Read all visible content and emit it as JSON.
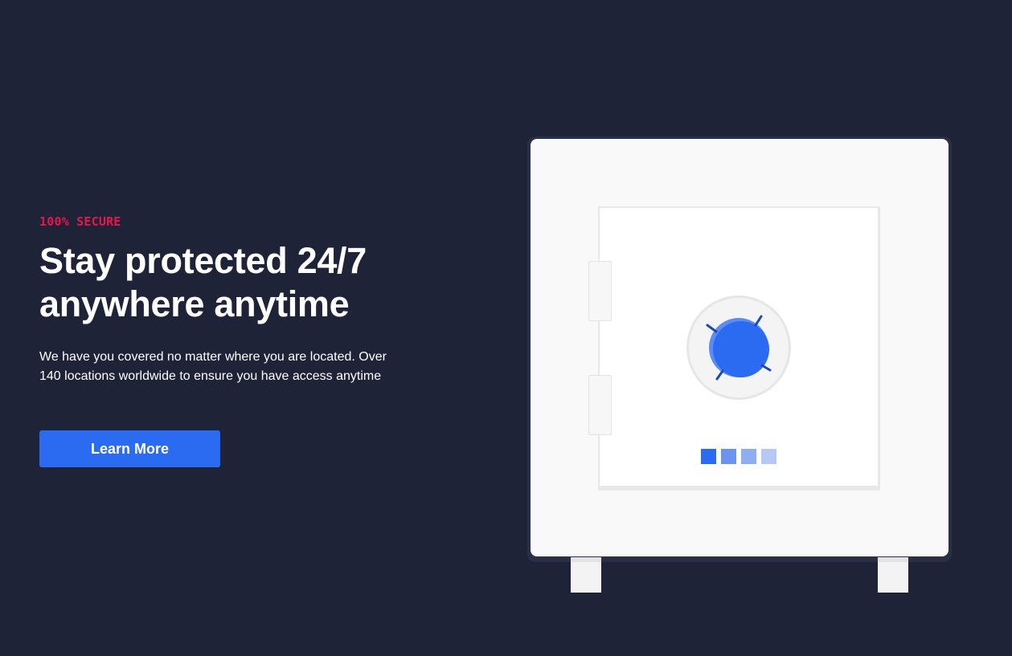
{
  "hero": {
    "eyebrow": "100% SECURE",
    "title": "Stay protected 24/7 anywhere anytime",
    "description": "We have you covered no matter where you are located. Over 140 locations worldwide to ensure you have access anytime",
    "cta_label": "Learn More"
  },
  "colors": {
    "background": "#1e2338",
    "accent": "#e8174a",
    "primary": "#2a6bf2",
    "money": "#63eaae"
  },
  "illustration": {
    "icon": "safe-icon"
  }
}
